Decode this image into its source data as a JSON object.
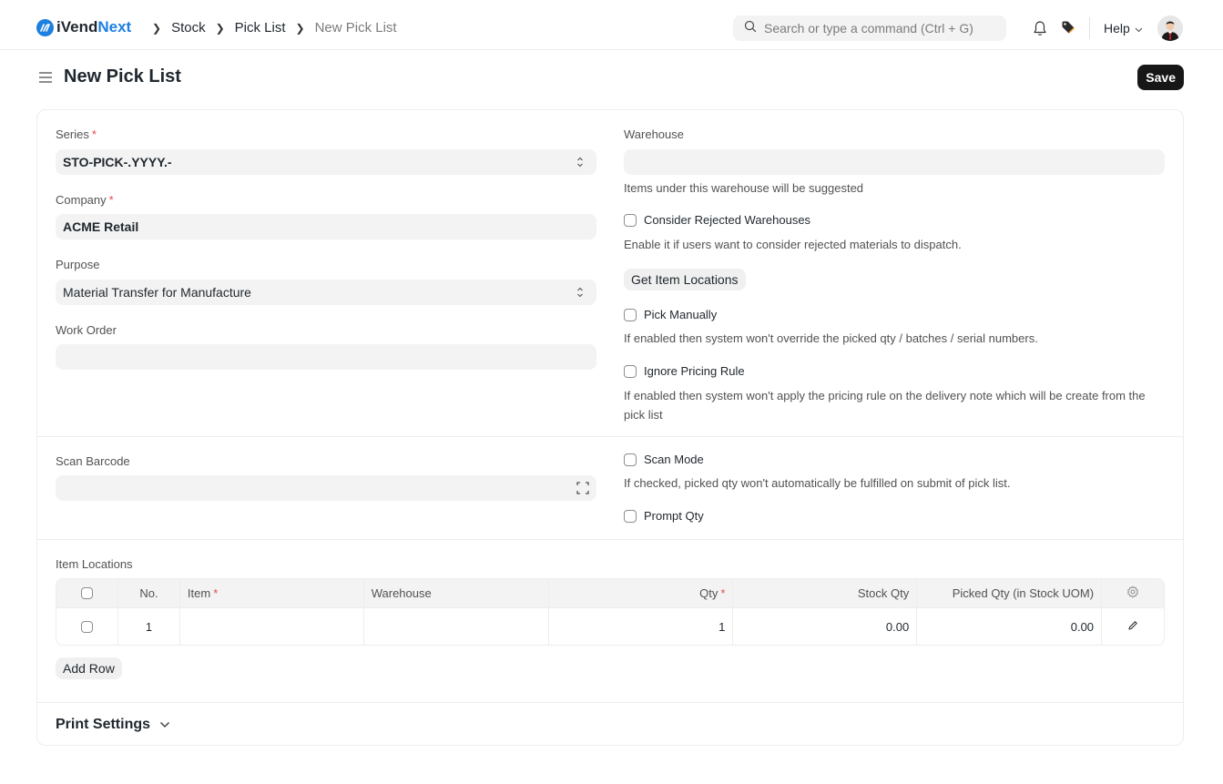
{
  "navbar": {
    "brand_prefix": "iVend",
    "brand_accent": "Next",
    "brand_color": "#1d7fe0",
    "breadcrumbs": [
      "Stock",
      "Pick List",
      "New Pick List"
    ],
    "search_placeholder": "Search or type a command (Ctrl + G)",
    "help_label": "Help"
  },
  "page": {
    "title": "New Pick List",
    "save_label": "Save"
  },
  "form": {
    "series": {
      "label": "Series",
      "value": "STO-PICK-.YYYY.-",
      "required": "*"
    },
    "company": {
      "label": "Company",
      "value": "ACME Retail",
      "required": "*"
    },
    "purpose": {
      "label": "Purpose",
      "value": "Material Transfer for Manufacture"
    },
    "work_order": {
      "label": "Work Order",
      "value": ""
    },
    "warehouse": {
      "label": "Warehouse",
      "value": "",
      "help": "Items under this warehouse will be suggested"
    },
    "consider_rejected": {
      "label": "Consider Rejected Warehouses",
      "checked": false,
      "help": "Enable it if users want to consider rejected materials to dispatch."
    },
    "get_item_locations_label": "Get Item Locations",
    "pick_manually": {
      "label": "Pick Manually",
      "checked": false,
      "help": "If enabled then system won't override the picked qty / batches / serial numbers."
    },
    "ignore_pricing_rule": {
      "label": "Ignore Pricing Rule",
      "checked": false,
      "help": "If enabled then system won't apply the pricing rule on the delivery note which will be create from the pick list"
    },
    "scan_barcode": {
      "label": "Scan Barcode",
      "value": ""
    },
    "scan_mode": {
      "label": "Scan Mode",
      "checked": false,
      "help": "If checked, picked qty won't automatically be fulfilled on submit of pick list."
    },
    "prompt_qty": {
      "label": "Prompt Qty",
      "checked": false
    }
  },
  "item_locations": {
    "label": "Item Locations",
    "columns": {
      "no": "No.",
      "item": "Item",
      "warehouse": "Warehouse",
      "qty": "Qty",
      "stock_qty": "Stock Qty",
      "picked_qty": "Picked Qty (in Stock UOM)",
      "required": "*"
    },
    "rows": [
      {
        "no": "1",
        "item": "",
        "warehouse": "",
        "qty": "1",
        "stock_qty": "0.00",
        "picked_qty": "0.00"
      }
    ],
    "add_row_label": "Add Row"
  },
  "print_settings": {
    "label": "Print Settings"
  }
}
